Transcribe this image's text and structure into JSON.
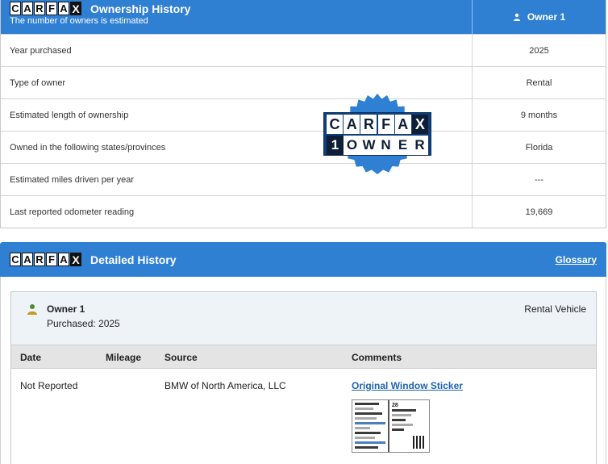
{
  "ownership": {
    "title": "Ownership History",
    "subtitle": "The number of owners is estimated",
    "owner_column": "Owner 1",
    "logo_letters": [
      "C",
      "A",
      "R",
      "F",
      "A",
      "X"
    ],
    "rows": [
      {
        "label": "Year purchased",
        "value": "2025"
      },
      {
        "label": "Type of owner",
        "value": "Rental"
      },
      {
        "label": "Estimated length of ownership",
        "value": "9 months"
      },
      {
        "label": "Owned in the following states/provinces",
        "value": "Florida"
      },
      {
        "label": "Estimated miles driven per year",
        "value": "---"
      },
      {
        "label": "Last reported odometer reading",
        "value": "19,669"
      }
    ]
  },
  "badge": {
    "row1": [
      "C",
      "A",
      "R",
      "F",
      "A",
      "X"
    ],
    "row2": [
      "1",
      "O",
      "W",
      "N",
      "E",
      "R"
    ],
    "color": "#2f7fd3"
  },
  "detailed": {
    "title": "Detailed History",
    "glossary_link": "Glossary",
    "owner_name": "Owner 1",
    "purchased": "Purchased: 2025",
    "owner_type": "Rental Vehicle",
    "columns": {
      "date": "Date",
      "mileage": "Mileage",
      "source": "Source",
      "comments": "Comments"
    },
    "record": {
      "date": "Not Reported",
      "mileage": "",
      "source": "BMW of North America, LLC",
      "comment_link": "Original Window Sticker",
      "thumb_price": "28"
    }
  },
  "colors": {
    "header_blue": "#2f7fd3",
    "link_blue": "#1f63b0",
    "badge_navy": "#0e3f7a"
  }
}
